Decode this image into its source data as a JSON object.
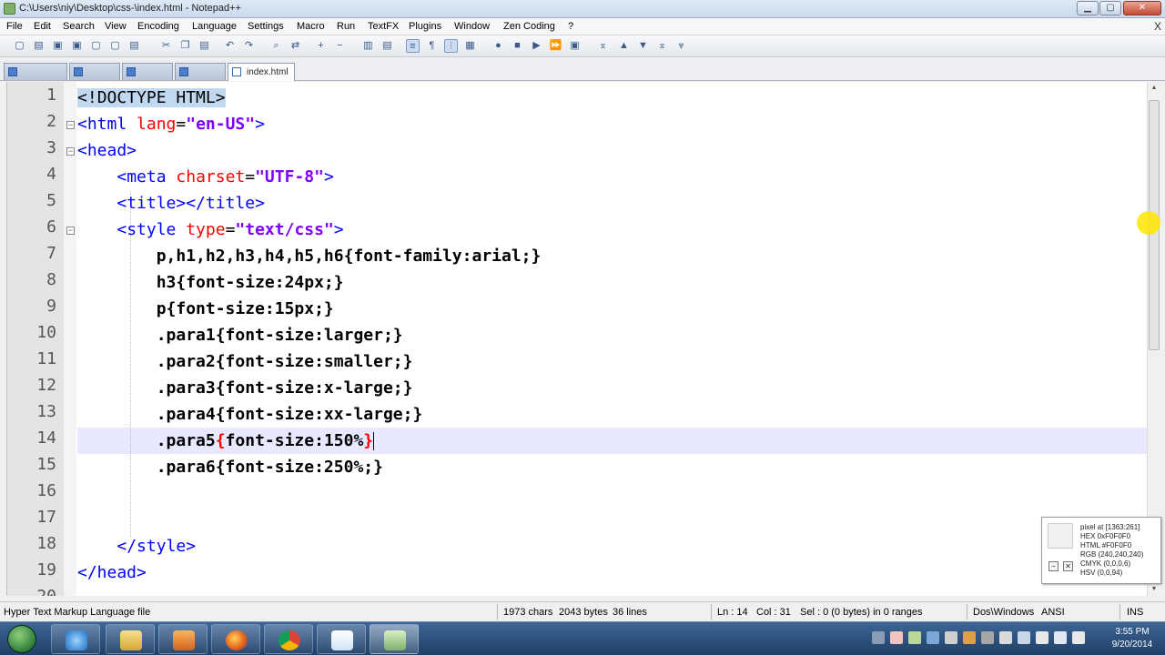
{
  "window": {
    "title": "C:\\Users\\niy\\Desktop\\css-\\index.html - Notepad++"
  },
  "menu": [
    "File",
    "Edit",
    "Search",
    "View",
    "Encoding",
    "Language",
    "Settings",
    "Macro",
    "Run",
    "TextFX",
    "Plugins",
    "Window",
    "Zen Coding",
    "?"
  ],
  "menu_close": "X",
  "tabs": {
    "active_label": "index.html"
  },
  "gutter": {
    "line_numbers": [
      "1",
      "2",
      "3",
      "4",
      "5",
      "6",
      "7",
      "8",
      "9",
      "10",
      "11",
      "12",
      "13",
      "14",
      "15",
      "16",
      "17",
      "18",
      "19",
      "20"
    ]
  },
  "code": {
    "l1": {
      "a": "<!",
      "b": "DOCTYPE HTML",
      "c": ">"
    },
    "l2": {
      "a": "<html ",
      "b": "lang",
      "c": "=",
      "d": "\"en-US\"",
      "e": ">"
    },
    "l3": {
      "a": "<head>"
    },
    "l4": {
      "indent": "    ",
      "a": "<meta ",
      "b": "charset",
      "c": "=",
      "d": "\"UTF-8\"",
      "e": ">"
    },
    "l5": {
      "indent": "    ",
      "a": "<title></title>"
    },
    "l6": {
      "indent": "    ",
      "a": "<style ",
      "b": "type",
      "c": "=",
      "d": "\"text/css\"",
      "e": ">"
    },
    "l7": {
      "indent": "        ",
      "a": "p,h1,h2,h3,h4,h5,h6{font-family:arial;}"
    },
    "l8": {
      "indent": "        ",
      "a": "h3{font-size:24px;}"
    },
    "l9": {
      "indent": "        ",
      "a": "p{font-size:15px;}"
    },
    "l10": {
      "indent": "        ",
      "a": ".para1{font-size:larger;}"
    },
    "l11": {
      "indent": "        ",
      "a": ".para2{font-size:smaller;}"
    },
    "l12": {
      "indent": "        ",
      "a": ".para3{font-size:x-large;}"
    },
    "l13": {
      "indent": "        ",
      "a": ".para4{font-size:xx-large;}"
    },
    "l14": {
      "indent": "        ",
      "a": ".para5",
      "b": "{",
      "c": "font-size:150%",
      "d": "}"
    },
    "l15": {
      "indent": "        ",
      "a": ".para6{font-size:250%;}"
    },
    "l18": {
      "indent": "    ",
      "a": "</style>"
    },
    "l19": {
      "a": "</head>"
    }
  },
  "pixel_info": {
    "title": "pixel at [1363:261]",
    "hex": "HEX 0xF0F0F0",
    "html": "HTML #F0F0F0",
    "rgb": "RGB (240,240,240)",
    "cmyk": "CMYK (0,0,0,6)",
    "hsv": "HSV (0,0,94)",
    "swatch_color": "#f0f0f0"
  },
  "status": {
    "file_type": "Hyper Text Markup Language file",
    "chars": "1973 chars",
    "bytes": "2043 bytes",
    "lines": "36 lines",
    "ln": "Ln : 14",
    "col": "Col : 31",
    "sel": "Sel : 0 (0 bytes) in 0 ranges",
    "eol": "Dos\\Windows",
    "encoding": "ANSI",
    "mode": "INS"
  },
  "clock": {
    "time": "3:55 PM",
    "date": "9/20/2014"
  },
  "colors": {
    "tag": "#0000ff",
    "attr": "#ff0000",
    "value": "#8000ff",
    "current_line": "#e8e8ff"
  }
}
